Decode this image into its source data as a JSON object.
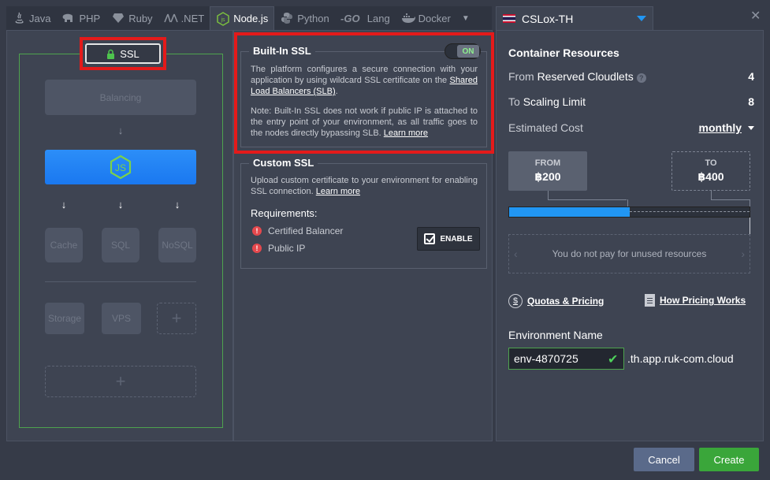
{
  "tabs": [
    {
      "id": "java",
      "label": "Java",
      "icon": "java-icon",
      "active": false
    },
    {
      "id": "php",
      "label": "PHP",
      "icon": "php-elephant-icon",
      "active": false
    },
    {
      "id": "ruby",
      "label": "Ruby",
      "icon": "ruby-gem-icon",
      "active": false
    },
    {
      "id": "net",
      "label": ".NET",
      "icon": "dotnet-icon",
      "active": false
    },
    {
      "id": "nodejs",
      "label": "Node.js",
      "icon": "nodejs-icon",
      "active": true
    },
    {
      "id": "python",
      "label": "Python",
      "icon": "python-icon",
      "active": false
    },
    {
      "id": "go",
      "label": "Lang",
      "icon": "go-logo-icon",
      "active": false
    },
    {
      "id": "docker",
      "label": "Docker",
      "icon": "docker-whale-icon",
      "active": false
    }
  ],
  "region": {
    "label": "CSLox-TH",
    "flag": "thailand-flag-icon"
  },
  "topology": {
    "ssl_label": "SSL",
    "balancing": "Balancing",
    "cache": "Cache",
    "sql": "SQL",
    "nosql": "NoSQL",
    "storage": "Storage",
    "vps": "VPS",
    "add": "+"
  },
  "builtin_ssl": {
    "title": "Built-In SSL",
    "toggle": "ON",
    "text1_pre": "The platform configures a secure connection with your application by using wildcard SSL certificate on the ",
    "text1_link": "Shared Load Balancers (SLB)",
    "text1_post": ".",
    "text2_pre": "Note: Built-In SSL does not work if public IP is attached to the entry point of your environment, as all traffic goes to the nodes directly bypassing SLB. ",
    "text2_link": "Learn more"
  },
  "custom_ssl": {
    "title": "Custom SSL",
    "text_pre": "Upload custom certificate to your environment for enabling SSL connection. ",
    "text_link": "Learn more",
    "requirements_title": "Requirements:",
    "requirements": [
      "Certified Balancer",
      "Public IP"
    ],
    "enable_label": "ENABLE"
  },
  "resources": {
    "title": "Container Resources",
    "reserved_pre": "From ",
    "reserved_label": "Reserved Cloudlets",
    "reserved_value": "4",
    "scaling_pre": "To ",
    "scaling_label": "Scaling Limit",
    "scaling_value": "8",
    "cost_label": "Estimated Cost",
    "cost_period": "monthly",
    "from_label": "FROM",
    "from_value": "฿200",
    "to_label": "TO",
    "to_value": "฿400",
    "bar_fill_fraction": 0.5,
    "unused_text": "You do not pay for unused resources",
    "quotas_link": "Quotas & Pricing",
    "pricing_link": "How Pricing Works"
  },
  "environment": {
    "label": "Environment Name",
    "value": "env-4870725",
    "suffix": ".th.app.ruk-com.cloud"
  },
  "footer": {
    "cancel": "Cancel",
    "create": "Create"
  },
  "colors": {
    "accent": "#2196f3",
    "highlight": "#e41a1a",
    "success": "#3aa63a"
  }
}
